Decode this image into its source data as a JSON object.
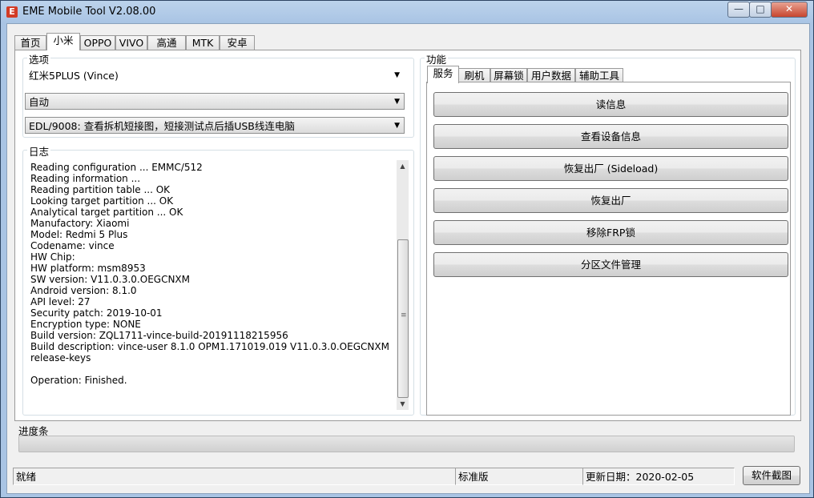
{
  "window": {
    "icon_letter": "E",
    "title": "EME Mobile Tool V2.08.00",
    "min_glyph": "—",
    "max_glyph": "□",
    "close_glyph": "✕"
  },
  "tabs": [
    "首页",
    "小米",
    "OPPO",
    "VIVO",
    "高通",
    "MTK",
    "安卓"
  ],
  "active_tab": "小米",
  "options": {
    "label": "选项",
    "model": "红米5PLUS (Vince)",
    "mode": "自动",
    "method": "EDL/9008: 查看拆机短接图，短接测试点后插USB线连电脑"
  },
  "log": {
    "label": "日志",
    "lines": [
      "Reading configuration ... EMMC/512",
      "Reading information ...",
      "Reading partition table ... OK",
      "Looking target partition ... OK",
      "Analytical target partition ... OK",
      "Manufactory: Xiaomi",
      "Model: Redmi 5 Plus",
      "Codename: vince",
      "HW Chip:",
      "HW platform: msm8953",
      "SW version: V11.0.3.0.OEGCNXM",
      "Android version: 8.1.0",
      "API level: 27",
      "Security patch: 2019-10-01",
      "Encryption type: NONE",
      "Build version: ZQL1711-vince-build-20191118215956",
      "Build description: vince-user 8.1.0 OPM1.171019.019 V11.0.3.0.OEGCNXM",
      "release-keys",
      "",
      "Operation: Finished."
    ]
  },
  "functions": {
    "label": "功能",
    "subtabs": [
      "服务",
      "刷机",
      "屏幕锁",
      "用户数据",
      "辅助工具"
    ],
    "active_subtab": "服务",
    "buttons": [
      "读信息",
      "查看设备信息",
      "恢复出厂 (Sideload)",
      "恢复出厂",
      "移除FRP锁",
      "分区文件管理"
    ]
  },
  "progress": {
    "label": "进度条",
    "value": 0
  },
  "status_bar": {
    "status": "就绪",
    "edition": "标准版",
    "update_date": "更新日期：2020-02-05",
    "screenshot_button": "软件截图"
  },
  "colors": {
    "titlebar": "#a9c4e4",
    "progress_fill": "#06b025",
    "app_icon": "#d23b25"
  }
}
